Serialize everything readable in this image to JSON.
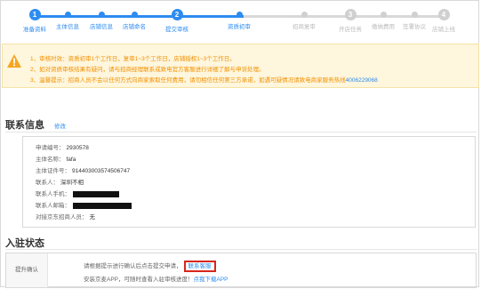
{
  "steps": [
    {
      "num": "1",
      "label": "准备资料",
      "state": "done"
    },
    {
      "num": "",
      "label": "主体信息",
      "state": "done"
    },
    {
      "num": "",
      "label": "店铺信息",
      "state": "done"
    },
    {
      "num": "",
      "label": "店铺命名",
      "state": "done"
    },
    {
      "num": "2",
      "label": "提交审核",
      "state": "done"
    },
    {
      "num": "",
      "label": "资质初审",
      "state": "done"
    },
    {
      "num": "",
      "label": "招商复审",
      "state": "future"
    },
    {
      "num": "3",
      "label": "开店任务",
      "state": "future"
    },
    {
      "num": "",
      "label": "缴纳费用",
      "state": "future"
    },
    {
      "num": "",
      "label": "签署协议",
      "state": "future"
    },
    {
      "num": "4",
      "label": "店铺上线",
      "state": "future"
    }
  ],
  "notice": {
    "lines": [
      "1、审核时效：资质初审1个工作日，复审1~3个工作日，店铺授权1~3个工作日。",
      "2、如对资质审核结果有疑问，请与招商经理联系或致电官方客服进行详细了解与申诉处理。",
      "3、温馨提示：招商人员不会以任何方式向商家索取任何费用，请勿相信任何第三方承诺，如遇可疑情况请致电商家服务热线"
    ],
    "hotline": "4006229068"
  },
  "contact": {
    "title": "联系信息",
    "edit_link": "修改",
    "rows": [
      {
        "label": "申请编号：",
        "value": "2930578"
      },
      {
        "label": "主体名称：",
        "value": "fafa"
      },
      {
        "label": "主体证件号：",
        "value": "914403003574506747"
      },
      {
        "label": "联系人：",
        "value": "深圳不相"
      },
      {
        "label": "联系人手机：",
        "value": ""
      },
      {
        "label": "联系人邮箱：",
        "value": ""
      },
      {
        "label": "对接京东招商人员：",
        "value": "无"
      }
    ]
  },
  "settle": {
    "title": "入驻状态",
    "row_label": "提升确认",
    "line1_text": "请根据提示进行确认后点击提交申请，",
    "line1_link": "联系客服",
    "line2_text": "安装京麦APP，可随时查看入驻审核进度！",
    "line2_link": "点我下载APP"
  },
  "colors": {
    "primary": "#2d8cf0",
    "warning_bg": "#fef6dd",
    "warning_text": "#f29100",
    "highlight_border": "#d8261c"
  }
}
